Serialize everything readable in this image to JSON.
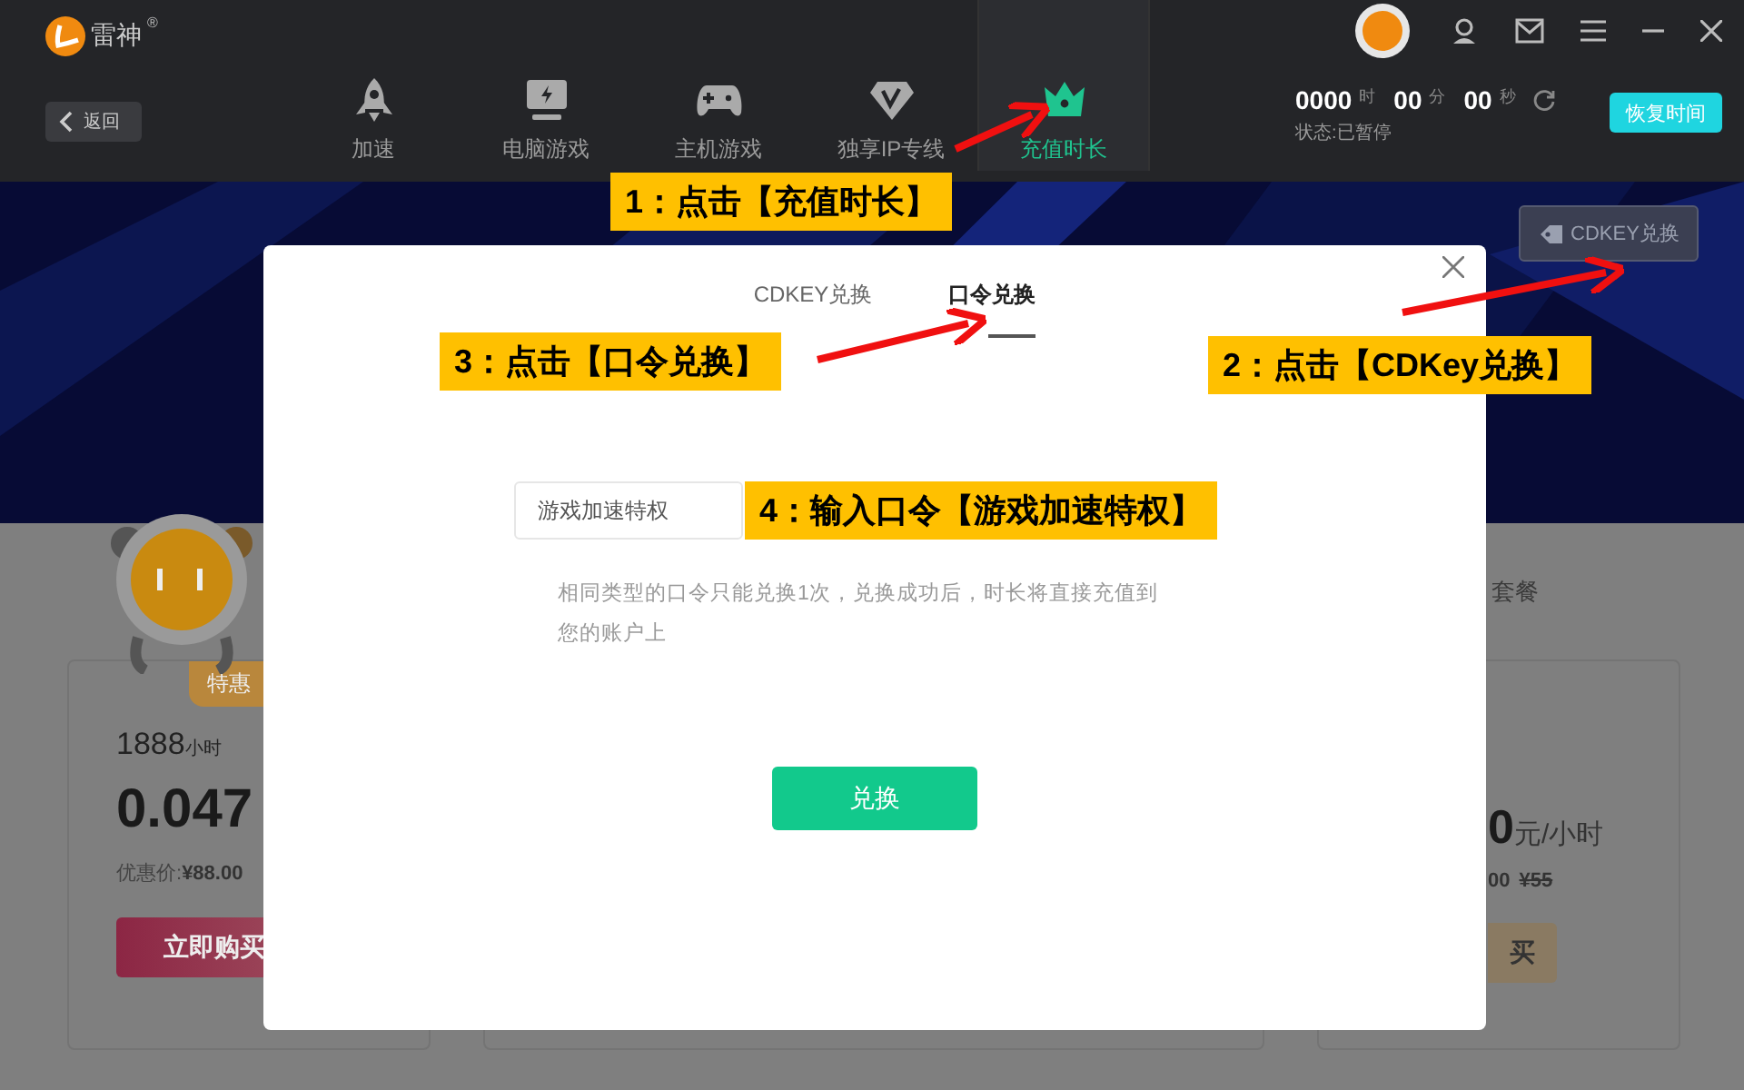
{
  "app": {
    "logo": "雷神",
    "registered": "®",
    "back": "返回"
  },
  "nav": [
    {
      "label": "加速",
      "selected": false
    },
    {
      "label": "电脑游戏",
      "selected": false
    },
    {
      "label": "主机游戏",
      "selected": false
    },
    {
      "label": "独享IP专线",
      "selected": false
    },
    {
      "label": "充值时长",
      "selected": true
    }
  ],
  "timer": {
    "hours": "0000",
    "hours_unit": "时",
    "minutes": "00",
    "minutes_unit": "分",
    "seconds": "00",
    "seconds_unit": "秒",
    "status": "状态:已暂停",
    "button": "恢复时间"
  },
  "banner": {
    "cdkey_button": "CDKEY兑换"
  },
  "packages": {
    "heading": "套餐",
    "left_card": {
      "badge": "特惠",
      "hours": "1888",
      "hours_unit": "小时",
      "price": "0.047",
      "deal_label": "优惠价:",
      "deal_price": "¥88.00",
      "buy": "立即购买"
    },
    "right_card": {
      "price": "0",
      "price_unit": "元/小时",
      "deal_price": "00",
      "original_price": "¥55",
      "buy": "买"
    }
  },
  "dialog": {
    "tabs": [
      {
        "label": "CDKEY兑换",
        "selected": false
      },
      {
        "label": "口令兑换",
        "selected": true
      }
    ],
    "code_input": {
      "value": "游戏加速特权"
    },
    "hint": "相同类型的口令只能兑换1次，兑换成功后，时长将直接充值到您的账户上",
    "submit": "兑换"
  },
  "annotations": [
    {
      "text": "1：点击【充值时长】"
    },
    {
      "text": "3：点击【口令兑换】"
    },
    {
      "text": "2：点击【CDKey兑换】"
    },
    {
      "text": "4：输入口令【游戏加速特权】"
    }
  ]
}
